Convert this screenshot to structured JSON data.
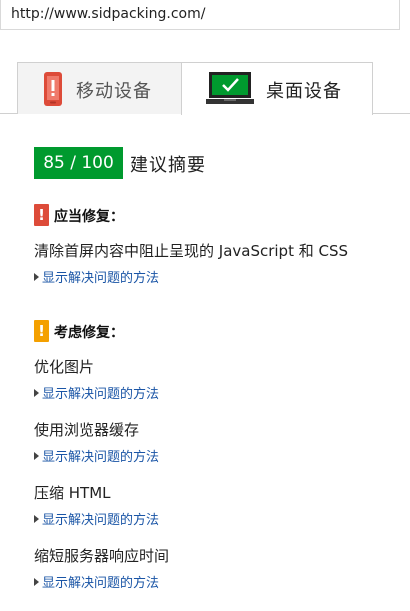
{
  "address_bar": {
    "url": "http://www.sidpacking.com/"
  },
  "tabs": [
    {
      "label": "移动设备",
      "icon": "mobile-phone-icon",
      "active": false
    },
    {
      "label": "桌面设备",
      "icon": "desktop-monitor-icon",
      "active": true
    }
  ],
  "score": {
    "value": "85 / 100",
    "title": "建议摘要",
    "color": "#009a2e"
  },
  "sections": {
    "should_fix": {
      "icon_glyph": "!",
      "icon_color": "#dd4b39",
      "title": "应当修复：",
      "rules": [
        {
          "title": "清除首屏内容中阻止呈现的 JavaScript 和 CSS",
          "link": "显示解决问题的方法"
        }
      ]
    },
    "consider_fixing": {
      "icon_glyph": "!",
      "icon_color": "#f4a000",
      "title": "考虑修复：",
      "rules": [
        {
          "title": "优化图片",
          "link": "显示解决问题的方法"
        },
        {
          "title": "使用浏览器缓存",
          "link": "显示解决问题的方法"
        },
        {
          "title": "压缩 HTML",
          "link": "显示解决问题的方法"
        },
        {
          "title": "缩短服务器响应时间",
          "link": "显示解决问题的方法"
        }
      ]
    }
  }
}
